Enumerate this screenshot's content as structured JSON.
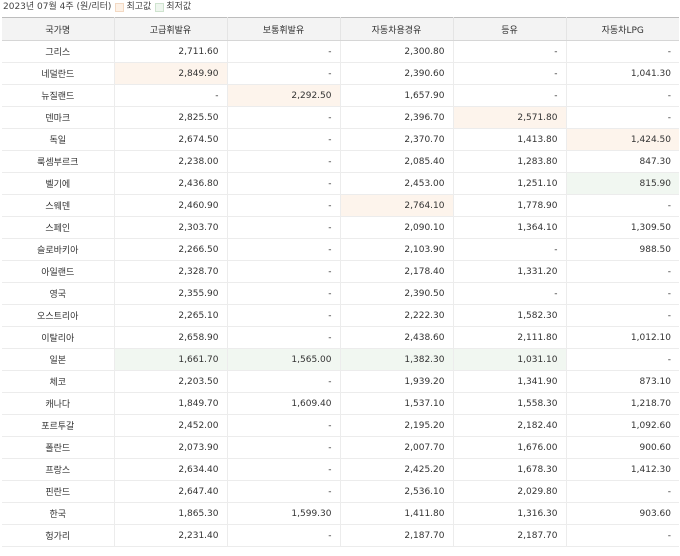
{
  "caption": {
    "period": "2023년 07월 4주",
    "unit": "(원/리터)",
    "legend_high": "최고값",
    "legend_low": "최저값"
  },
  "colors": {
    "high": "#fdf4ec",
    "low": "#f1f7f1"
  },
  "table": {
    "columns": [
      "국가명",
      "고급휘발유",
      "보통휘발유",
      "자동차용경유",
      "등유",
      "자동차LPG"
    ],
    "rows": [
      {
        "country": "그리스",
        "values": [
          "2,711.60",
          "-",
          "2,300.80",
          "-",
          "-"
        ],
        "highlight": [
          "",
          "",
          "",
          "",
          ""
        ]
      },
      {
        "country": "네덜란드",
        "values": [
          "2,849.90",
          "-",
          "2,390.60",
          "-",
          "1,041.30"
        ],
        "highlight": [
          "high",
          "",
          "",
          "",
          ""
        ]
      },
      {
        "country": "뉴질랜드",
        "values": [
          "-",
          "2,292.50",
          "1,657.90",
          "-",
          "-"
        ],
        "highlight": [
          "",
          "high",
          "",
          "",
          ""
        ]
      },
      {
        "country": "덴마크",
        "values": [
          "2,825.50",
          "-",
          "2,396.70",
          "2,571.80",
          "-"
        ],
        "highlight": [
          "",
          "",
          "",
          "high",
          ""
        ]
      },
      {
        "country": "독일",
        "values": [
          "2,674.50",
          "-",
          "2,370.70",
          "1,413.80",
          "1,424.50"
        ],
        "highlight": [
          "",
          "",
          "",
          "",
          "high"
        ]
      },
      {
        "country": "룩셈부르크",
        "values": [
          "2,238.00",
          "-",
          "2,085.40",
          "1,283.80",
          "847.30"
        ],
        "highlight": [
          "",
          "",
          "",
          "",
          ""
        ]
      },
      {
        "country": "벨기에",
        "values": [
          "2,436.80",
          "-",
          "2,453.00",
          "1,251.10",
          "815.90"
        ],
        "highlight": [
          "",
          "",
          "",
          "",
          "low"
        ]
      },
      {
        "country": "스웨덴",
        "values": [
          "2,460.90",
          "-",
          "2,764.10",
          "1,778.90",
          "-"
        ],
        "highlight": [
          "",
          "",
          "high",
          "",
          ""
        ]
      },
      {
        "country": "스페인",
        "values": [
          "2,303.70",
          "-",
          "2,090.10",
          "1,364.10",
          "1,309.50"
        ],
        "highlight": [
          "",
          "",
          "",
          "",
          ""
        ]
      },
      {
        "country": "슬로바키아",
        "values": [
          "2,266.50",
          "-",
          "2,103.90",
          "-",
          "988.50"
        ],
        "highlight": [
          "",
          "",
          "",
          "",
          ""
        ]
      },
      {
        "country": "아일랜드",
        "values": [
          "2,328.70",
          "-",
          "2,178.40",
          "1,331.20",
          "-"
        ],
        "highlight": [
          "",
          "",
          "",
          "",
          ""
        ]
      },
      {
        "country": "영국",
        "values": [
          "2,355.90",
          "-",
          "2,390.50",
          "-",
          "-"
        ],
        "highlight": [
          "",
          "",
          "",
          "",
          ""
        ]
      },
      {
        "country": "오스트리아",
        "values": [
          "2,265.10",
          "-",
          "2,222.30",
          "1,582.30",
          "-"
        ],
        "highlight": [
          "",
          "",
          "",
          "",
          ""
        ]
      },
      {
        "country": "이탈리아",
        "values": [
          "2,658.90",
          "-",
          "2,438.60",
          "2,111.80",
          "1,012.10"
        ],
        "highlight": [
          "",
          "",
          "",
          "",
          ""
        ]
      },
      {
        "country": "일본",
        "values": [
          "1,661.70",
          "1,565.00",
          "1,382.30",
          "1,031.10",
          "-"
        ],
        "highlight": [
          "low",
          "low",
          "low",
          "low",
          ""
        ]
      },
      {
        "country": "체코",
        "values": [
          "2,203.50",
          "-",
          "1,939.20",
          "1,341.90",
          "873.10"
        ],
        "highlight": [
          "",
          "",
          "",
          "",
          ""
        ]
      },
      {
        "country": "캐나다",
        "values": [
          "1,849.70",
          "1,609.40",
          "1,537.10",
          "1,558.30",
          "1,218.70"
        ],
        "highlight": [
          "",
          "",
          "",
          "",
          ""
        ]
      },
      {
        "country": "포르투갈",
        "values": [
          "2,452.00",
          "-",
          "2,195.20",
          "2,182.40",
          "1,092.60"
        ],
        "highlight": [
          "",
          "",
          "",
          "",
          ""
        ]
      },
      {
        "country": "폴란드",
        "values": [
          "2,073.90",
          "-",
          "2,007.70",
          "1,676.00",
          "900.60"
        ],
        "highlight": [
          "",
          "",
          "",
          "",
          ""
        ]
      },
      {
        "country": "프랑스",
        "values": [
          "2,634.40",
          "-",
          "2,425.20",
          "1,678.30",
          "1,412.30"
        ],
        "highlight": [
          "",
          "",
          "",
          "",
          ""
        ]
      },
      {
        "country": "핀란드",
        "values": [
          "2,647.40",
          "-",
          "2,536.10",
          "2,029.80",
          "-"
        ],
        "highlight": [
          "",
          "",
          "",
          "",
          ""
        ]
      },
      {
        "country": "한국",
        "values": [
          "1,865.30",
          "1,599.30",
          "1,411.80",
          "1,316.30",
          "903.60"
        ],
        "highlight": [
          "",
          "",
          "",
          "",
          ""
        ]
      },
      {
        "country": "헝가리",
        "values": [
          "2,231.40",
          "-",
          "2,187.70",
          "2,187.70",
          "-"
        ],
        "highlight": [
          "",
          "",
          "",
          "",
          ""
        ]
      }
    ]
  }
}
